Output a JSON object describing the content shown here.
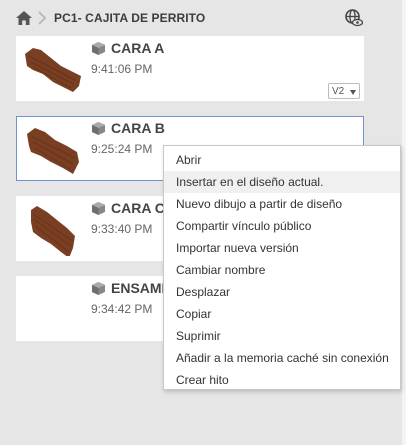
{
  "breadcrumb": {
    "title": "PC1- CAJITA DE PERRITO",
    "home_icon": "home-icon",
    "separator_icon": "chevron-right-icon",
    "share_icon": "globe-eye-icon"
  },
  "cards": [
    {
      "name": "CARA A",
      "time": "9:41:06 PM",
      "version": "V2"
    },
    {
      "name": "CARA B",
      "time": "9:25:24 PM"
    },
    {
      "name": "CARA C",
      "time": "9:33:40 PM"
    },
    {
      "name": "ENSAMB",
      "time": "9:34:42 PM"
    }
  ],
  "context_menu": {
    "items": [
      "Abrir",
      "Insertar en el diseño actual.",
      "Nuevo dibujo a partir de diseño",
      "Compartir vínculo público",
      "Importar nueva versión",
      "Cambiar nombre",
      "Desplazar",
      "Copiar",
      "Suprimir",
      "Añadir a la memoria caché sin conexión",
      "Crear hito"
    ],
    "hovered_index": 1
  },
  "colors": {
    "background": "#e6e6e6",
    "selection_border": "#6f93cc",
    "wood": "#7a3f22"
  }
}
